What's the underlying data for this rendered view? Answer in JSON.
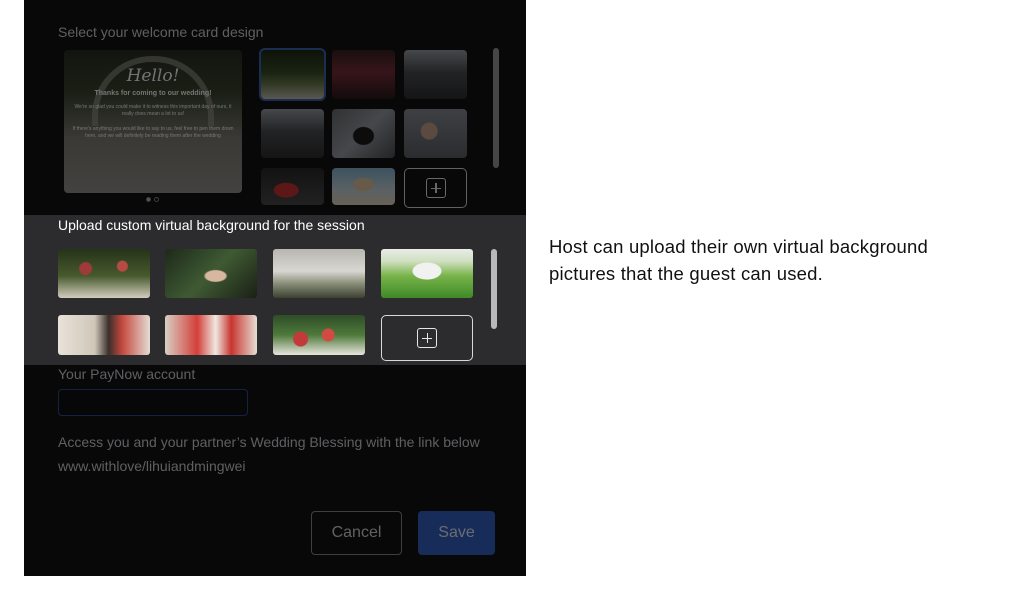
{
  "design_section": {
    "label": "Select your welcome card design",
    "card": {
      "hello": "Hello!",
      "thanks": "Thanks for coming to our wedding!",
      "message_1": "We're so glad you could make it to witness this important day of ours, it really does mean a lot to us!",
      "message_2": "If there's anything you would like to say to us, feel free to pen them down here, and we will definitely be reading them after the wedding"
    },
    "pagination": {
      "current": 1,
      "total": 2
    }
  },
  "upload_section": {
    "title": "Upload custom virtual background for the session"
  },
  "paynow": {
    "label": "Your PayNow account",
    "value": ""
  },
  "blessing": {
    "description": "Access you and your partner’s Wedding Blessing with the link below",
    "link": "www.withlove/lihuiandmingwei"
  },
  "actions": {
    "cancel_label": "Cancel",
    "save_label": "Save"
  },
  "annotation": {
    "text": "Host can upload their own virtual background pictures that the guest can used."
  },
  "colors": {
    "panel_bg": "#131315",
    "highlight_bg": "#2c2c2e",
    "accent": "#3463c4"
  },
  "icons": [
    "plus-square-icon"
  ]
}
